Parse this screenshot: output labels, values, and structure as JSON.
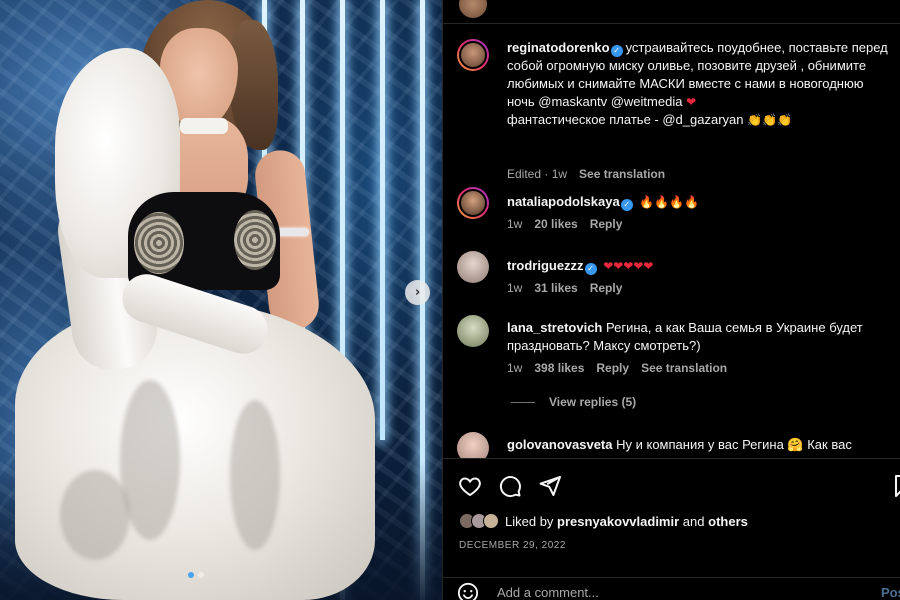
{
  "post": {
    "author": "reginatodorenko",
    "caption_parts": [
      "устраивайтесь поудобнее, поставьте перед собой огромную миску оливье, позовите друзей , обнимите любимых и снимайте МАСКИ вместе с нами в новогоднюю ночь @maskantv @weitmedia",
      "фантастическое платье - @d_gazaryan"
    ],
    "caption_emoji_1": "❤",
    "caption_emoji_2": "👏👏👏",
    "meta_edited": "Edited · 1w",
    "see_translation": "See translation"
  },
  "comments": [
    {
      "user": "nataliapodolskaya",
      "verified": true,
      "text": "🔥🔥🔥🔥",
      "age": "1w",
      "likes": "20 likes",
      "reply": "Reply"
    },
    {
      "user": "trodriguezzz",
      "verified": true,
      "text": "❤❤❤❤❤",
      "age": "1w",
      "likes": "31 likes",
      "reply": "Reply"
    },
    {
      "user": "lana_stretovich",
      "verified": false,
      "text": "Регина, а как Ваша семья в Украине будет праздновать? Максу смотреть?)",
      "age": "1w",
      "likes": "398 likes",
      "reply": "Reply",
      "translation": "See translation"
    },
    {
      "user": "golovanovasveta",
      "verified": false,
      "text": "Ну и компания у вас Регина 🤗 Как вас"
    }
  ],
  "view_replies": "View replies (5)",
  "liked_by": {
    "prefix": "Liked by",
    "user": "presnyakovvladimir",
    "connector": "and",
    "others": "others"
  },
  "date": "DECEMBER 29, 2022",
  "add_comment": {
    "placeholder": "Add a comment...",
    "post_label": "Post"
  },
  "icons": [
    "heart-icon",
    "comment-icon",
    "share-icon",
    "bookmark-icon",
    "emoji-icon",
    "chevron-right-icon"
  ],
  "colors": {
    "background": "#000000",
    "verified": "#3897f0",
    "muted": "#a8a8a8",
    "heart": "#e8283d"
  }
}
